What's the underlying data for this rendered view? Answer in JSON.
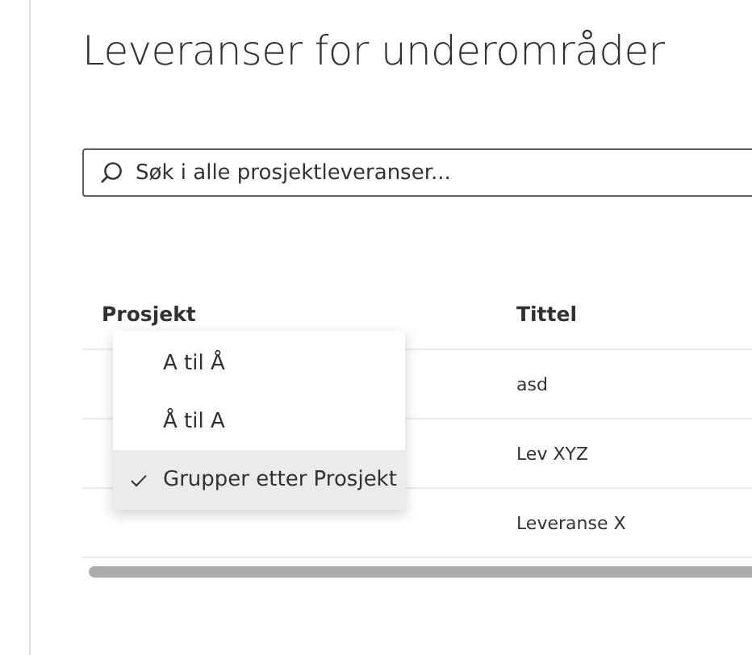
{
  "title": "Leveranser for underområder",
  "search": {
    "placeholder": "Søk i alle prosjektleveranser..."
  },
  "table": {
    "columns": [
      "Prosjekt",
      "Tittel"
    ],
    "rows": [
      {
        "title": "asd"
      },
      {
        "title": "Lev XYZ"
      },
      {
        "title": "Leveranse X"
      }
    ]
  },
  "sort_menu": {
    "items": [
      {
        "label": "A til Å",
        "checked": false,
        "selected": false
      },
      {
        "label": "Å til A",
        "checked": false,
        "selected": false
      },
      {
        "label": "Grupper etter Prosjekt",
        "checked": true,
        "selected": true
      }
    ]
  }
}
